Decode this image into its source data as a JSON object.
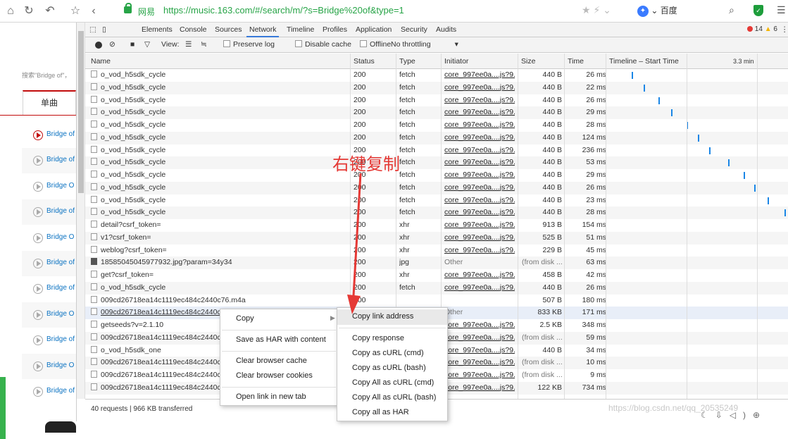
{
  "browser": {
    "site_name": "网易",
    "url": "https://music.163.com/#/search/m/?s=Bridge%20of&type=1",
    "search_engine": "百度"
  },
  "page": {
    "search_note": "搜索\"Bridge of\"，",
    "tab_label": "单曲",
    "songs": [
      "Bridge of",
      "Bridge of",
      "Bridge O",
      "Bridge of",
      "Bridge O",
      "Bridge of",
      "Bridge of",
      "Bridge O",
      "Bridge of",
      "Bridge O",
      "Bridge of"
    ]
  },
  "devtools": {
    "tabs": [
      "Elements",
      "Console",
      "Sources",
      "Network",
      "Timeline",
      "Profiles",
      "Application",
      "Security",
      "Audits"
    ],
    "active_tab": "Network",
    "error_count": "14",
    "warning_count": "6",
    "toolbar": {
      "view_label": "View:",
      "preserve_log": "Preserve log",
      "disable_cache": "Disable cache",
      "offline": "Offline",
      "throttling": "No throttling"
    },
    "columns": [
      "Name",
      "Status",
      "Type",
      "Initiator",
      "Size",
      "Time",
      "Timeline – Start Time"
    ],
    "timeline_marker": "3.3 min",
    "rows": [
      {
        "name": "o_vod_h5sdk_cycle",
        "status": "200",
        "type": "fetch",
        "initiator": "core_997ee0a....js?9...",
        "size": "440 B",
        "time": "26 ms"
      },
      {
        "name": "o_vod_h5sdk_cycle",
        "status": "200",
        "type": "fetch",
        "initiator": "core_997ee0a....js?9...",
        "size": "440 B",
        "time": "22 ms"
      },
      {
        "name": "o_vod_h5sdk_cycle",
        "status": "200",
        "type": "fetch",
        "initiator": "core_997ee0a....js?9...",
        "size": "440 B",
        "time": "26 ms"
      },
      {
        "name": "o_vod_h5sdk_cycle",
        "status": "200",
        "type": "fetch",
        "initiator": "core_997ee0a....js?9...",
        "size": "440 B",
        "time": "29 ms"
      },
      {
        "name": "o_vod_h5sdk_cycle",
        "status": "200",
        "type": "fetch",
        "initiator": "core_997ee0a....js?9...",
        "size": "440 B",
        "time": "28 ms"
      },
      {
        "name": "o_vod_h5sdk_cycle",
        "status": "200",
        "type": "fetch",
        "initiator": "core_997ee0a....js?9...",
        "size": "440 B",
        "time": "124 ms"
      },
      {
        "name": "o_vod_h5sdk_cycle",
        "status": "200",
        "type": "fetch",
        "initiator": "core_997ee0a....js?9...",
        "size": "440 B",
        "time": "236 ms"
      },
      {
        "name": "o_vod_h5sdk_cycle",
        "status": "200",
        "type": "fetch",
        "initiator": "core_997ee0a....js?9...",
        "size": "440 B",
        "time": "53 ms"
      },
      {
        "name": "o_vod_h5sdk_cycle",
        "status": "200",
        "type": "fetch",
        "initiator": "core_997ee0a....js?9...",
        "size": "440 B",
        "time": "29 ms"
      },
      {
        "name": "o_vod_h5sdk_cycle",
        "status": "200",
        "type": "fetch",
        "initiator": "core_997ee0a....js?9...",
        "size": "440 B",
        "time": "26 ms"
      },
      {
        "name": "o_vod_h5sdk_cycle",
        "status": "200",
        "type": "fetch",
        "initiator": "core_997ee0a....js?9...",
        "size": "440 B",
        "time": "23 ms"
      },
      {
        "name": "o_vod_h5sdk_cycle",
        "status": "200",
        "type": "fetch",
        "initiator": "core_997ee0a....js?9...",
        "size": "440 B",
        "time": "28 ms"
      },
      {
        "name": "detail?csrf_token=",
        "status": "200",
        "type": "xhr",
        "initiator": "core_997ee0a....js?9...",
        "size": "913 B",
        "time": "154 ms"
      },
      {
        "name": "v1?csrf_token=",
        "status": "200",
        "type": "xhr",
        "initiator": "core_997ee0a....js?9...",
        "size": "525 B",
        "time": "51 ms"
      },
      {
        "name": "weblog?csrf_token=",
        "status": "200",
        "type": "xhr",
        "initiator": "core_997ee0a....js?9...",
        "size": "229 B",
        "time": "45 ms"
      },
      {
        "name": "18585045045977932.jpg?param=34y34",
        "status": "200",
        "type": "jpg",
        "initiator": "Other",
        "size": "(from disk ...",
        "time": "63 ms"
      },
      {
        "name": "get?csrf_token=",
        "status": "200",
        "type": "xhr",
        "initiator": "core_997ee0a....js?9...",
        "size": "458 B",
        "time": "42 ms"
      },
      {
        "name": "o_vod_h5sdk_cycle",
        "status": "200",
        "type": "fetch",
        "initiator": "core_997ee0a....js?9...",
        "size": "440 B",
        "time": "26 ms"
      },
      {
        "name": "009cd26718ea14c1119ec484c2440c76.m4a",
        "status": "200",
        "type": "",
        "initiator": "",
        "size": "507 B",
        "time": "180 ms"
      },
      {
        "name": "009cd26718ea14c1119ec484c2440c76.m4a",
        "status": "",
        "type": "",
        "initiator": "Other",
        "size": "833 KB",
        "time": "171 ms"
      },
      {
        "name": "getseeds?v=2.1.10",
        "status": "",
        "type": "",
        "initiator": "core_997ee0a....js?9...",
        "size": "2.5 KB",
        "time": "348 ms"
      },
      {
        "name": "009cd26718ea14c1119ec484c2440c76",
        "status": "",
        "type": "",
        "initiator": "core_997ee0a....js?9...",
        "size": "(from disk ...",
        "time": "59 ms"
      },
      {
        "name": "o_vod_h5sdk_one",
        "status": "",
        "type": "",
        "initiator": "core_997ee0a....js?9...",
        "size": "440 B",
        "time": "34 ms"
      },
      {
        "name": "009cd26718ea14c1119ec484c2440c76",
        "status": "",
        "type": "",
        "initiator": "core_997ee0a....js?9...",
        "size": "(from disk ...",
        "time": "10 ms"
      },
      {
        "name": "009cd26718ea14c1119ec484c2440c76",
        "status": "",
        "type": "",
        "initiator": "core_997ee0a....js?9...",
        "size": "(from disk ...",
        "time": "9 ms"
      },
      {
        "name": "009cd26718ea14c1119ec484c2440c76",
        "status": "",
        "type": "",
        "initiator": "core_997ee0a....js?9...",
        "size": "122 KB",
        "time": "734 ms"
      }
    ],
    "status_bar": "40 requests  |  966 KB transferred"
  },
  "context_menu": {
    "items": [
      "Copy",
      "Save as HAR with content",
      "Clear browser cache",
      "Clear browser cookies",
      "Open link in new tab"
    ]
  },
  "submenu": {
    "items": [
      "Copy link address",
      "Copy response",
      "Copy as cURL (cmd)",
      "Copy as cURL (bash)",
      "Copy All as cURL (cmd)",
      "Copy All as cURL (bash)",
      "Copy all as HAR"
    ]
  },
  "annotation": {
    "text": "右键复制",
    "color": "#e53935"
  },
  "watermark": "https://blog.csdn.net/qq_20535249"
}
